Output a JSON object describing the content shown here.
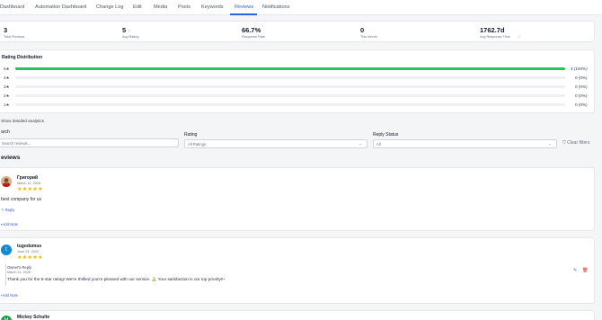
{
  "tabs": [
    {
      "label": "Dashboard",
      "active": false
    },
    {
      "label": "Automation Dashboard",
      "active": false
    },
    {
      "label": "Change Log",
      "active": false
    },
    {
      "label": "Edit",
      "active": false
    },
    {
      "label": "Media",
      "active": false
    },
    {
      "label": "Posts",
      "active": false
    },
    {
      "label": "Keywords",
      "active": false
    },
    {
      "label": "Reviews",
      "active": true
    },
    {
      "label": "Notifications",
      "active": false
    }
  ],
  "stats": {
    "total_reviews": {
      "value": "3",
      "label": "Total Reviews"
    },
    "avg_rating": {
      "value": "5",
      "label": "Avg Rating"
    },
    "response_rate": {
      "value": "66.7%",
      "label": "Response Rate"
    },
    "this_month": {
      "value": "0",
      "label": "This Month"
    },
    "avg_response_time": {
      "value": "1762.7d",
      "label": "Avg Response Time"
    }
  },
  "distribution": {
    "title": "Rating Distribution",
    "rows": [
      {
        "label": "5★",
        "count": "3 (100%)",
        "fraction": 1.0
      },
      {
        "label": "4★",
        "count": "0 (0%)",
        "fraction": 0
      },
      {
        "label": "3★",
        "count": "0 (0%)",
        "fraction": 0
      },
      {
        "label": "2★",
        "count": "0 (0%)",
        "fraction": 0
      },
      {
        "label": "1★",
        "count": "0 (0%)",
        "fraction": 0
      }
    ]
  },
  "detailed_toggle": "Show detailed analytics",
  "filters": {
    "search_label": "arch",
    "search_placeholder": "Search reviews...",
    "rating_label": "Rating",
    "rating_value": "All Ratings",
    "reply_label": "Reply Status",
    "reply_value": "All",
    "clear_label": "Clear filters"
  },
  "reviews_heading": "eviews",
  "reviews": [
    {
      "name": "Григорий",
      "date": "March 11, 2026",
      "stars": "★★★★★",
      "rating": 5,
      "text": "best company for us",
      "reply_link": "Reply",
      "add_note": "Add Note"
    },
    {
      "name": "tugodumus",
      "initial": "t",
      "date": "June 24, 2022",
      "stars": "★★★★★",
      "rating": 5,
      "owner_reply_label": "Owner's Reply",
      "owner_reply_date": "March 11, 2026",
      "owner_reply_text": "Thank you for the 5-star rating! We're thrilled you're pleased with our service. 🙏 Your satisfaction is our top priority!!!",
      "add_note": "Add Note"
    },
    {
      "name": "Mickey Schulte",
      "initial": "M"
    }
  ],
  "colors": {
    "accent": "#2563eb",
    "bar_fill": "#22c55e",
    "star": "#f5b301",
    "delete": "#dc2626"
  }
}
